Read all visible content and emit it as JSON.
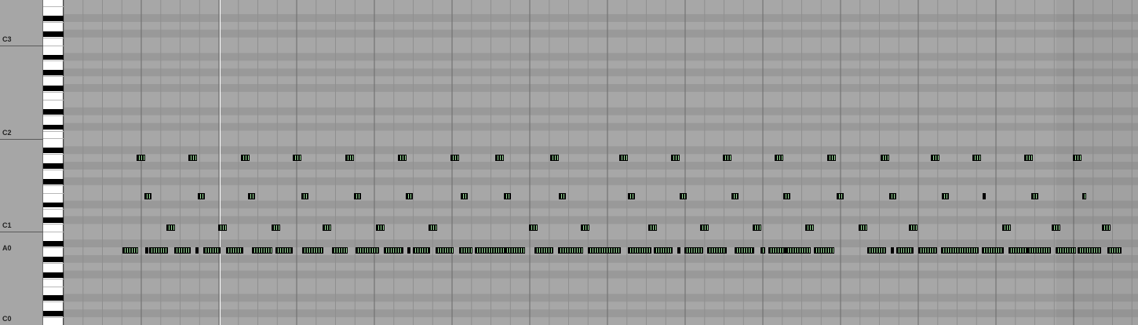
{
  "piano_roll": {
    "octave_labels": [
      {
        "name": "C3",
        "label": "C3",
        "line": true
      },
      {
        "name": "C2",
        "label": "C2",
        "line": true
      },
      {
        "name": "C1",
        "label": "C1",
        "line": true
      },
      {
        "name": "A0",
        "label": "A0",
        "line": false
      },
      {
        "name": "C0",
        "label": "C0",
        "line": false
      }
    ],
    "colors": {
      "grid_light": "#a9a9a9",
      "grid_dark_band": "#999999",
      "bar_line": "#6a6a6a",
      "beat_line": "#8f8f8f",
      "note_fill": "#000000",
      "note_highlight": "#9fe29f",
      "playhead": "#ffffff"
    },
    "notes": {
      "row_1": {
        "pattern": "repeating",
        "count": 18
      },
      "row_2": {
        "pattern": "repeating",
        "count": 19
      },
      "row_3": {
        "pattern": "repeating",
        "count": 18
      },
      "row_4": {
        "pattern": "dense",
        "count": 38
      }
    }
  }
}
